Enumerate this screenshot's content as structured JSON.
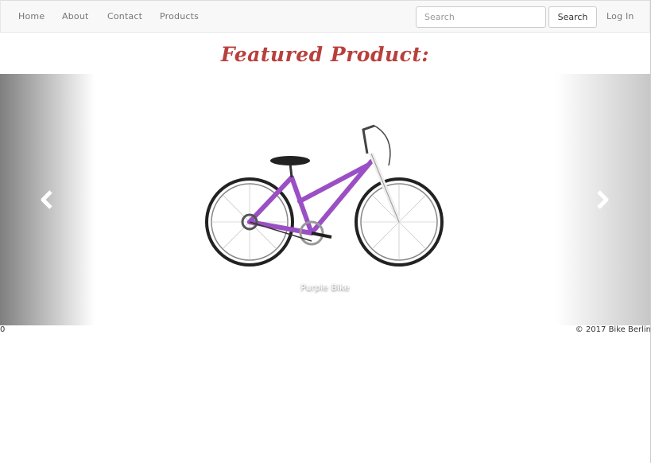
{
  "nav": {
    "links": [
      "Home",
      "About",
      "Contact",
      "Products"
    ],
    "search_placeholder": "Search",
    "search_button": "Search",
    "login": "Log In"
  },
  "main": {
    "title": "Featured Product:"
  },
  "carousel": {
    "caption": "Purple Bike",
    "prev_icon": "chevron-left-icon",
    "next_icon": "chevron-right-icon"
  },
  "footer": {
    "left_text": "0",
    "copyright": "© 2017 Bike Berlin"
  },
  "colors": {
    "title": "#b8403c",
    "bike_frame": "#9b4fc4",
    "navbar_bg": "#f8f8f8"
  }
}
